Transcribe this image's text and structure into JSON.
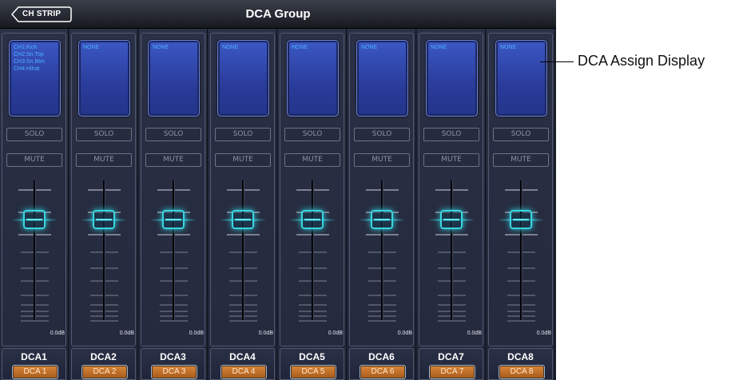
{
  "header": {
    "back_label": "CH STRIP",
    "title": "DCA Group"
  },
  "strips": [
    {
      "assign": [
        "CH1:Kick",
        "CH2:Sn.Top",
        "CH3:Sn.Btm",
        "CH4:Hihat"
      ],
      "solo": "SOLO",
      "mute": "MUTE",
      "level": "0.0dB",
      "name": "DCA1",
      "badge": "DCA 1"
    },
    {
      "assign": [
        "NONE"
      ],
      "solo": "SOLO",
      "mute": "MUTE",
      "level": "0.0dB",
      "name": "DCA2",
      "badge": "DCA 2"
    },
    {
      "assign": [
        "NONE"
      ],
      "solo": "SOLO",
      "mute": "MUTE",
      "level": "0.0dB",
      "name": "DCA3",
      "badge": "DCA 3"
    },
    {
      "assign": [
        "NONE"
      ],
      "solo": "SOLO",
      "mute": "MUTE",
      "level": "0.0dB",
      "name": "DCA4",
      "badge": "DCA 4"
    },
    {
      "assign": [
        "NONE"
      ],
      "solo": "SOLO",
      "mute": "MUTE",
      "level": "0.0dB",
      "name": "DCA5",
      "badge": "DCA 5"
    },
    {
      "assign": [
        "NONE"
      ],
      "solo": "SOLO",
      "mute": "MUTE",
      "level": "0.0dB",
      "name": "DCA6",
      "badge": "DCA 6"
    },
    {
      "assign": [
        "NONE"
      ],
      "solo": "SOLO",
      "mute": "MUTE",
      "level": "0.0dB",
      "name": "DCA7",
      "badge": "DCA 7"
    },
    {
      "assign": [
        "NONE"
      ],
      "solo": "SOLO",
      "mute": "MUTE",
      "level": "0.0dB",
      "name": "DCA8",
      "badge": "DCA 8"
    }
  ],
  "fader_position_fraction": 0.72,
  "callout": {
    "label": "DCA Assign Display"
  },
  "colors": {
    "accent_cyan": "#39d6e0",
    "badge_orange": "#c9772f",
    "assign_text": "#4fb0ff",
    "panel_bg": "#1e2333"
  }
}
